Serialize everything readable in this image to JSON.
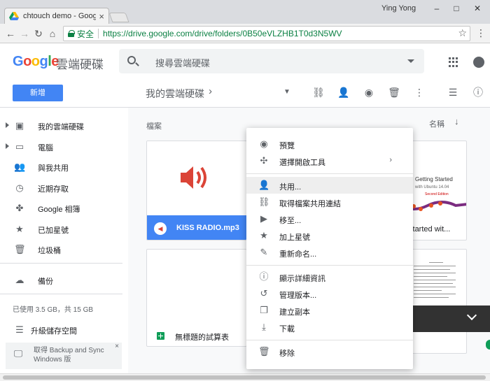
{
  "browser": {
    "tab_title": "chtouch demo - Google",
    "tab_close": "×",
    "user": "Ying Yong",
    "win_min": "–",
    "win_max": "□",
    "win_close": "✕",
    "secure_label": "安全",
    "url": "https://drive.google.com/drive/folders/0B50eVLZHB1T0d3N5WV"
  },
  "drive": {
    "logo_letters": [
      "G",
      "o",
      "o",
      "g",
      "l",
      "e"
    ],
    "product_name": "雲端硬碟",
    "search_placeholder": "搜尋雲端硬碟",
    "new_button": "新增",
    "breadcrumb": "我的雲端硬碟",
    "breadcrumb_chevron": "›"
  },
  "sidebar": {
    "items": [
      {
        "label": "我的雲端硬碟",
        "icon": "drive-icon"
      },
      {
        "label": "電腦",
        "icon": "computer-icon"
      },
      {
        "label": "與我共用",
        "icon": "shared-icon"
      },
      {
        "label": "近期存取",
        "icon": "clock-icon"
      },
      {
        "label": "Google 相簿",
        "icon": "photos-icon"
      },
      {
        "label": "已加星號",
        "icon": "star-icon"
      },
      {
        "label": "垃圾桶",
        "icon": "trash-icon"
      },
      {
        "label": "備份",
        "icon": "cloud-icon"
      }
    ],
    "storage_text": "已使用 3.5 GB，共 15 GB",
    "upgrade_label": "升級儲存空間",
    "backup_text": "取得 Backup and Sync Windows 版",
    "backup_close": "×"
  },
  "main": {
    "section_label": "檔案",
    "sort_label": "名稱",
    "files": [
      {
        "name": "KISS RADIO.mp3",
        "type": "audio"
      },
      {
        "name": "g Started wit...",
        "type": "pdf"
      },
      {
        "name": "無標題的試算表",
        "type": "spreadsheet"
      }
    ],
    "book": {
      "title_line1": "Getting Started",
      "title_line2": "with Ubuntu 14.04",
      "edition": "Second Edition"
    }
  },
  "context_menu": {
    "items": [
      {
        "label": "預覽",
        "icon": "eye-icon"
      },
      {
        "label": "選擇開啟工具",
        "icon": "open-with-icon",
        "submenu": true
      },
      {
        "label": "共用...",
        "icon": "share-icon",
        "hover": true
      },
      {
        "label": "取得檔案共用連結",
        "icon": "link-icon"
      },
      {
        "label": "移至...",
        "icon": "move-icon"
      },
      {
        "label": "加上星號",
        "icon": "star-icon"
      },
      {
        "label": "重新命名...",
        "icon": "rename-icon"
      },
      {
        "label": "顯示詳細資訊",
        "icon": "info-icon"
      },
      {
        "label": "管理版本...",
        "icon": "history-icon"
      },
      {
        "label": "建立副本",
        "icon": "copy-icon"
      },
      {
        "label": "下載",
        "icon": "download-icon"
      },
      {
        "label": "移除",
        "icon": "trash-icon"
      }
    ]
  },
  "colors": {
    "primary": "#4285f4",
    "audio_red": "#db4437",
    "sheet_green": "#0f9d58",
    "secure_green": "#0b8043"
  }
}
